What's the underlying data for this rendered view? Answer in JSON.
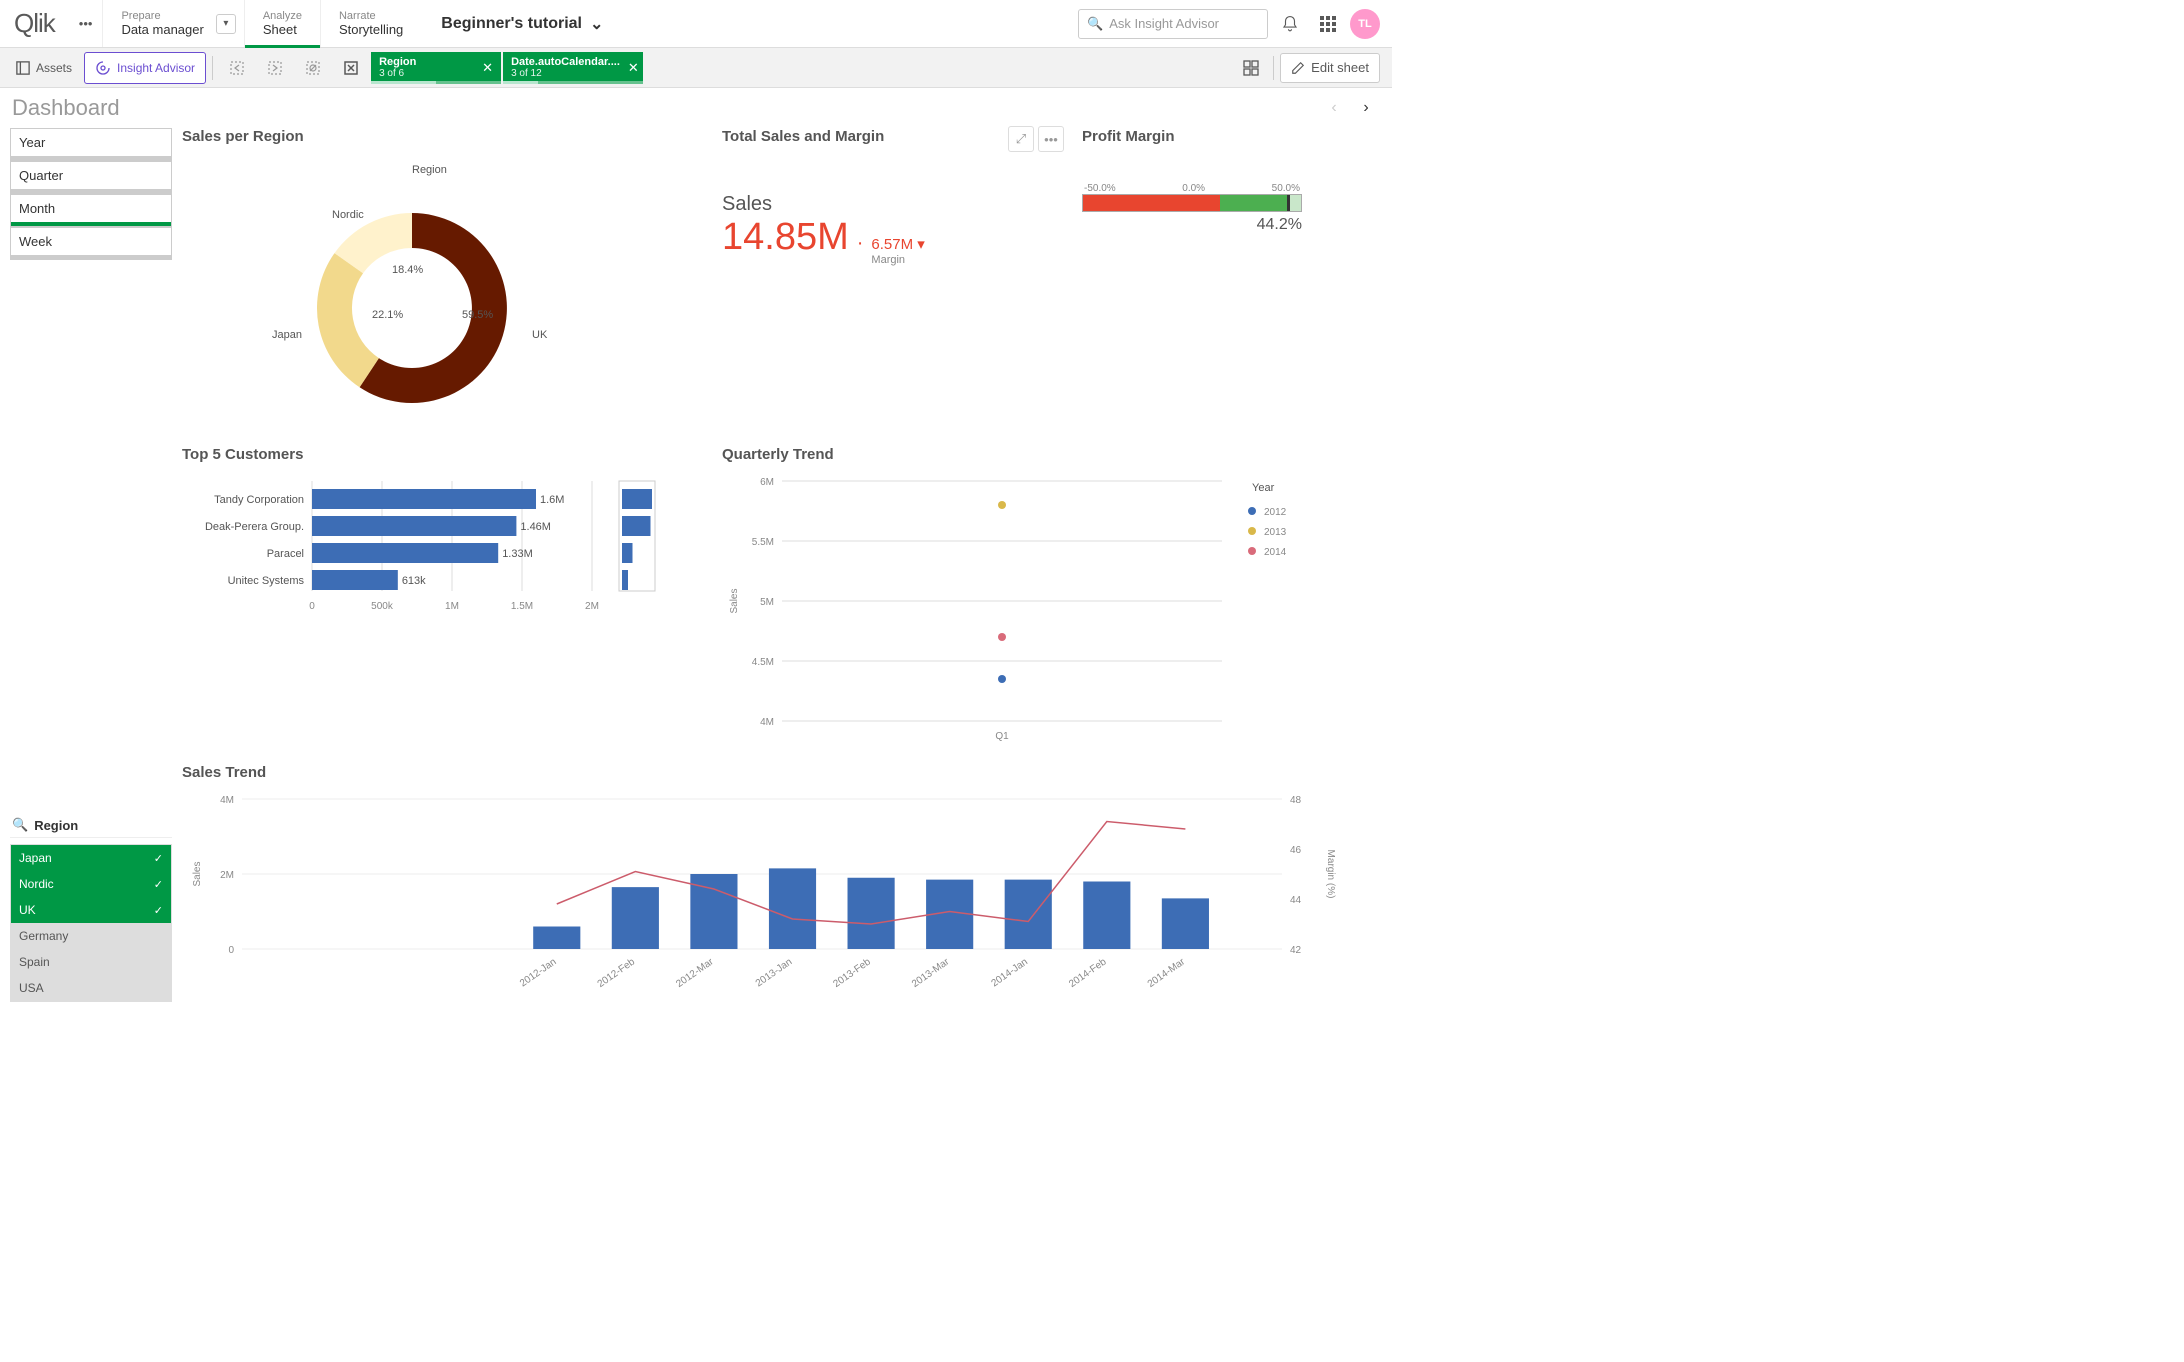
{
  "nav": {
    "logo": "Qlik",
    "tabs": [
      {
        "small": "Prepare",
        "big": "Data manager"
      },
      {
        "small": "Analyze",
        "big": "Sheet"
      },
      {
        "small": "Narrate",
        "big": "Storytelling"
      }
    ],
    "title": "Beginner's tutorial",
    "search_placeholder": "Ask Insight Advisor",
    "avatar": "TL"
  },
  "toolbar": {
    "assets": "Assets",
    "insight": "Insight Advisor",
    "selections": [
      {
        "title": "Region",
        "count": "3 of 6",
        "fill": 50
      },
      {
        "title": "Date.autoCalendar....",
        "count": "3 of 12",
        "fill": 25
      }
    ],
    "edit": "Edit sheet"
  },
  "sheet": {
    "title": "Dashboard"
  },
  "filters": {
    "items": [
      "Year",
      "Quarter",
      "Month",
      "Week"
    ],
    "region_label": "Region",
    "regions": [
      {
        "name": "Japan",
        "sel": true
      },
      {
        "name": "Nordic",
        "sel": true
      },
      {
        "name": "UK",
        "sel": true
      },
      {
        "name": "Germany",
        "sel": false
      },
      {
        "name": "Spain",
        "sel": false
      },
      {
        "name": "USA",
        "sel": false
      }
    ]
  },
  "kpi": {
    "title": "Total Sales and Margin",
    "label": "Sales",
    "value": "14.85M",
    "side_value": "6.57M",
    "side_arrow": "▾",
    "side_label": "Margin"
  },
  "gauge": {
    "title": "Profit Margin",
    "ticks": [
      "-50.0%",
      "0.0%",
      "50.0%"
    ],
    "value": "44.2%"
  },
  "chart_data": {
    "donut": {
      "type": "pie",
      "title": "Sales per Region",
      "legend_title": "Region",
      "series": [
        {
          "name": "UK",
          "value": 59.5,
          "color": "#661a00"
        },
        {
          "name": "Japan",
          "value": 22.1,
          "color": "#f2d98c"
        },
        {
          "name": "Nordic",
          "value": 18.4,
          "color": "#fff2cc"
        }
      ]
    },
    "top5": {
      "type": "bar",
      "title": "Top 5 Customers",
      "xlabel": "",
      "ylabel": "",
      "xlim": [
        0,
        2000000
      ],
      "xticks": [
        "0",
        "500k",
        "1M",
        "1.5M",
        "2M"
      ],
      "categories": [
        "Tandy Corporation",
        "Deak-Perera Group.",
        "Paracel",
        "Unitec Systems"
      ],
      "values": [
        1600000,
        1460000,
        1330000,
        613000
      ],
      "labels": [
        "1.6M",
        "1.46M",
        "1.33M",
        "613k"
      ],
      "mini": [
        100,
        95,
        35,
        20
      ]
    },
    "quarterly": {
      "type": "scatter",
      "title": "Quarterly Trend",
      "xlabel": "",
      "ylabel": "Sales",
      "ylim": [
        4000000,
        6000000
      ],
      "yticks": [
        "4M",
        "4.5M",
        "5M",
        "5.5M",
        "6M"
      ],
      "x_categories": [
        "Q1"
      ],
      "legend_title": "Year",
      "series": [
        {
          "name": "2012",
          "color": "#3d6db5",
          "points": [
            {
              "x": "Q1",
              "y": 4350000
            }
          ]
        },
        {
          "name": "2013",
          "color": "#d9b84a",
          "points": [
            {
              "x": "Q1",
              "y": 5800000
            }
          ]
        },
        {
          "name": "2014",
          "color": "#d96b7a",
          "points": [
            {
              "x": "Q1",
              "y": 4700000
            }
          ]
        }
      ]
    },
    "salestrend": {
      "type": "bar",
      "title": "Sales Trend",
      "ylabel": "Sales",
      "y2label": "Margin (%)",
      "ylim": [
        0,
        4000000
      ],
      "yticks": [
        "0",
        "2M",
        "4M"
      ],
      "y2lim": [
        42,
        48
      ],
      "y2ticks": [
        "42",
        "44",
        "46",
        "48"
      ],
      "categories": [
        "2012-Jan",
        "2012-Feb",
        "2012-Mar",
        "2013-Jan",
        "2013-Feb",
        "2013-Mar",
        "2014-Jan",
        "2014-Feb",
        "2014-Mar"
      ],
      "bars": [
        600000,
        1650000,
        2000000,
        2150000,
        1900000,
        1850000,
        1850000,
        1800000,
        1350000
      ],
      "line": [
        43.8,
        45.1,
        44.4,
        43.2,
        43.0,
        43.5,
        43.1,
        47.1,
        46.8
      ]
    }
  }
}
